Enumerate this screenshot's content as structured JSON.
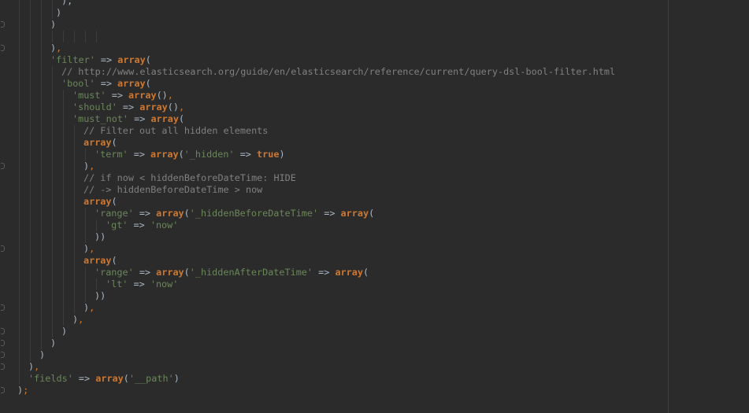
{
  "editor": {
    "lines": [
      {
        "indent": 10,
        "tokens": [
          [
            "pn",
            "),"
          ]
        ]
      },
      {
        "indent": 9,
        "tokens": [
          [
            "pn",
            ")"
          ]
        ]
      },
      {
        "indent": 8,
        "tokens": [
          [
            "pn",
            ")"
          ]
        ]
      },
      {
        "indent": 0,
        "tokens": []
      },
      {
        "indent": 8,
        "tokens": [
          [
            "pn",
            ")"
          ],
          [
            "sep",
            ","
          ]
        ]
      },
      {
        "indent": 8,
        "tokens": [
          [
            "str",
            "'filter'"
          ],
          [
            "op",
            " => "
          ],
          [
            "kw",
            "array"
          ],
          [
            "pn",
            "("
          ]
        ]
      },
      {
        "indent": 10,
        "tokens": [
          [
            "cm",
            "// http://www.elasticsearch.org/guide/en/elasticsearch/reference/current/query-dsl-bool-filter.html"
          ]
        ]
      },
      {
        "indent": 10,
        "tokens": [
          [
            "str",
            "'bool'"
          ],
          [
            "op",
            " => "
          ],
          [
            "kw",
            "array"
          ],
          [
            "pn",
            "("
          ]
        ]
      },
      {
        "indent": 12,
        "tokens": [
          [
            "str",
            "'must'"
          ],
          [
            "op",
            " => "
          ],
          [
            "kw",
            "array"
          ],
          [
            "pn",
            "()"
          ],
          [
            "sep",
            ","
          ]
        ]
      },
      {
        "indent": 12,
        "tokens": [
          [
            "str",
            "'should'"
          ],
          [
            "op",
            " => "
          ],
          [
            "kw",
            "array"
          ],
          [
            "pn",
            "()"
          ],
          [
            "sep",
            ","
          ]
        ]
      },
      {
        "indent": 12,
        "tokens": [
          [
            "str",
            "'must_not'"
          ],
          [
            "op",
            " => "
          ],
          [
            "kw",
            "array"
          ],
          [
            "pn",
            "("
          ]
        ]
      },
      {
        "indent": 14,
        "tokens": [
          [
            "cm",
            "// Filter out all hidden elements"
          ]
        ]
      },
      {
        "indent": 14,
        "tokens": [
          [
            "kw",
            "array"
          ],
          [
            "pn",
            "("
          ]
        ]
      },
      {
        "indent": 16,
        "tokens": [
          [
            "str",
            "'term'"
          ],
          [
            "op",
            " => "
          ],
          [
            "kw",
            "array"
          ],
          [
            "pn",
            "("
          ],
          [
            "str",
            "'_hidden'"
          ],
          [
            "op",
            " => "
          ],
          [
            "kw",
            "true"
          ],
          [
            "pn",
            ")"
          ]
        ]
      },
      {
        "indent": 14,
        "tokens": [
          [
            "pn",
            ")"
          ],
          [
            "sep",
            ","
          ]
        ]
      },
      {
        "indent": 14,
        "tokens": [
          [
            "cm",
            "// if now < hiddenBeforeDateTime: HIDE"
          ]
        ]
      },
      {
        "indent": 14,
        "tokens": [
          [
            "cm",
            "// -> hiddenBeforeDateTime > now"
          ]
        ]
      },
      {
        "indent": 14,
        "tokens": [
          [
            "kw",
            "array"
          ],
          [
            "pn",
            "("
          ]
        ]
      },
      {
        "indent": 16,
        "tokens": [
          [
            "str",
            "'range'"
          ],
          [
            "op",
            " => "
          ],
          [
            "kw",
            "array"
          ],
          [
            "pn",
            "("
          ],
          [
            "str",
            "'_hiddenBeforeDateTime'"
          ],
          [
            "op",
            " => "
          ],
          [
            "kw",
            "array"
          ],
          [
            "pn",
            "("
          ]
        ]
      },
      {
        "indent": 18,
        "tokens": [
          [
            "str",
            "'gt'"
          ],
          [
            "op",
            " => "
          ],
          [
            "str",
            "'now'"
          ]
        ]
      },
      {
        "indent": 16,
        "tokens": [
          [
            "pn",
            "))"
          ]
        ]
      },
      {
        "indent": 14,
        "tokens": [
          [
            "pn",
            ")"
          ],
          [
            "sep",
            ","
          ]
        ]
      },
      {
        "indent": 14,
        "tokens": [
          [
            "kw",
            "array"
          ],
          [
            "pn",
            "("
          ]
        ]
      },
      {
        "indent": 16,
        "tokens": [
          [
            "str",
            "'range'"
          ],
          [
            "op",
            " => "
          ],
          [
            "kw",
            "array"
          ],
          [
            "pn",
            "("
          ],
          [
            "str",
            "'_hiddenAfterDateTime'"
          ],
          [
            "op",
            " => "
          ],
          [
            "kw",
            "array"
          ],
          [
            "pn",
            "("
          ]
        ]
      },
      {
        "indent": 18,
        "tokens": [
          [
            "str",
            "'lt'"
          ],
          [
            "op",
            " => "
          ],
          [
            "str",
            "'now'"
          ]
        ]
      },
      {
        "indent": 16,
        "tokens": [
          [
            "pn",
            "))"
          ]
        ]
      },
      {
        "indent": 14,
        "tokens": [
          [
            "pn",
            ")"
          ],
          [
            "sep",
            ","
          ]
        ]
      },
      {
        "indent": 12,
        "tokens": [
          [
            "pn",
            ")"
          ],
          [
            "sep",
            ","
          ]
        ]
      },
      {
        "indent": 10,
        "tokens": [
          [
            "pn",
            ")"
          ]
        ]
      },
      {
        "indent": 8,
        "tokens": [
          [
            "pn",
            ")"
          ]
        ]
      },
      {
        "indent": 6,
        "tokens": [
          [
            "pn",
            ")"
          ]
        ]
      },
      {
        "indent": 4,
        "tokens": [
          [
            "pn",
            ")"
          ],
          [
            "sep",
            ","
          ]
        ]
      },
      {
        "indent": 4,
        "tokens": [
          [
            "str",
            "'fields'"
          ],
          [
            "op",
            " => "
          ],
          [
            "kw",
            "array"
          ],
          [
            "pn",
            "("
          ],
          [
            "str",
            "'__path'"
          ],
          [
            "pn",
            ")"
          ]
        ]
      },
      {
        "indent": 2,
        "tokens": [
          [
            "pn",
            ")"
          ],
          [
            "sep",
            ";"
          ]
        ]
      }
    ],
    "colors": {
      "background": "#2b2b2b",
      "string": "#6a8759",
      "keyword": "#cc7832",
      "comment": "#808080",
      "text": "#a9b7c6"
    }
  }
}
